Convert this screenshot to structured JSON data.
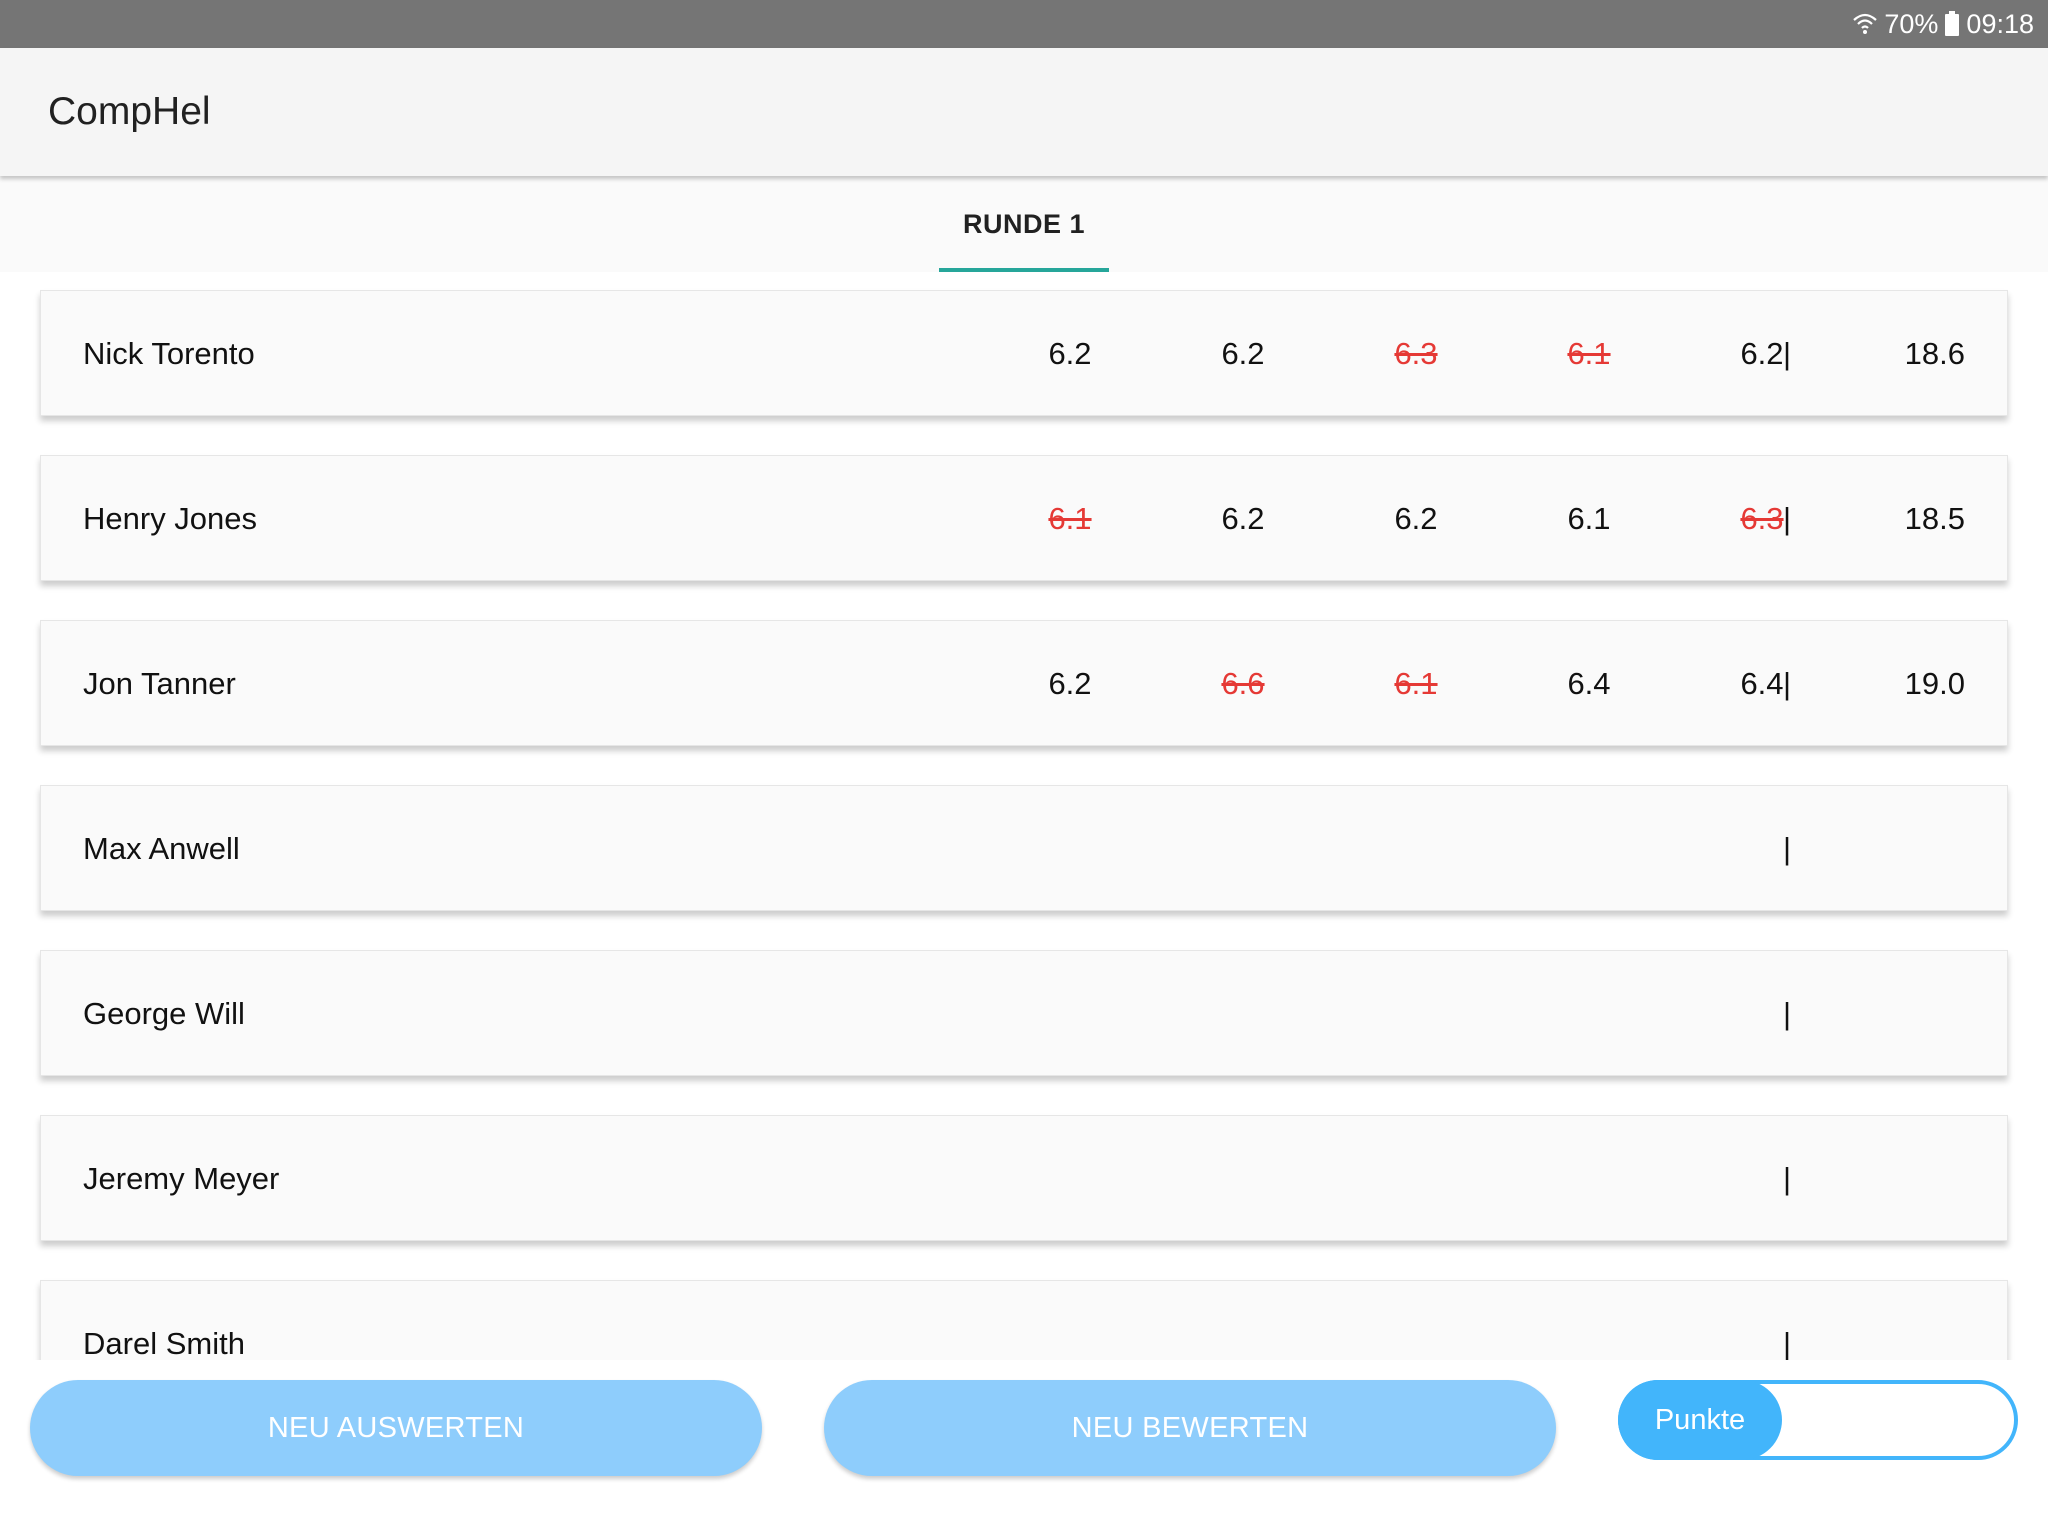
{
  "status_bar": {
    "battery": "70%",
    "time": "09:18",
    "icons": [
      "wifi-icon",
      "battery-icon"
    ]
  },
  "app_bar": {
    "title": "CompHel"
  },
  "tabs": [
    {
      "label": "RUNDE 1",
      "active": true
    }
  ],
  "rows": [
    {
      "name": "Nick Torento",
      "scores": [
        {
          "v": "6.2",
          "s": false
        },
        {
          "v": "6.2",
          "s": false
        },
        {
          "v": "6.3",
          "s": true
        },
        {
          "v": "6.1",
          "s": true
        },
        {
          "v": "6.2",
          "s": false
        }
      ],
      "sep": "|",
      "total": "18.6"
    },
    {
      "name": "Henry Jones",
      "scores": [
        {
          "v": "6.1",
          "s": true
        },
        {
          "v": "6.2",
          "s": false
        },
        {
          "v": "6.2",
          "s": false
        },
        {
          "v": "6.1",
          "s": false
        },
        {
          "v": "6.3",
          "s": true
        }
      ],
      "sep": "|",
      "total": "18.5"
    },
    {
      "name": "Jon Tanner",
      "scores": [
        {
          "v": "6.2",
          "s": false
        },
        {
          "v": "6.6",
          "s": true
        },
        {
          "v": "6.1",
          "s": true
        },
        {
          "v": "6.4",
          "s": false
        },
        {
          "v": "6.4",
          "s": false
        }
      ],
      "sep": "|",
      "total": "19.0"
    },
    {
      "name": "Max Anwell",
      "scores": [],
      "sep": "|",
      "total": ""
    },
    {
      "name": "George Will",
      "scores": [],
      "sep": "|",
      "total": ""
    },
    {
      "name": "Jeremy Meyer",
      "scores": [],
      "sep": "|",
      "total": ""
    },
    {
      "name": "Darel Smith",
      "scores": [],
      "sep": "|",
      "total": ""
    }
  ],
  "buttons": {
    "evaluate_label": "NEU AUSWERTEN",
    "rate_label": "NEU BEWERTEN"
  },
  "toggle": {
    "label": "Punkte",
    "on": true
  },
  "colors": {
    "accent_tab": "#26a69a",
    "button": "#8ecdfc",
    "toggle": "#42b5fb",
    "struck_score": "#e53935"
  }
}
